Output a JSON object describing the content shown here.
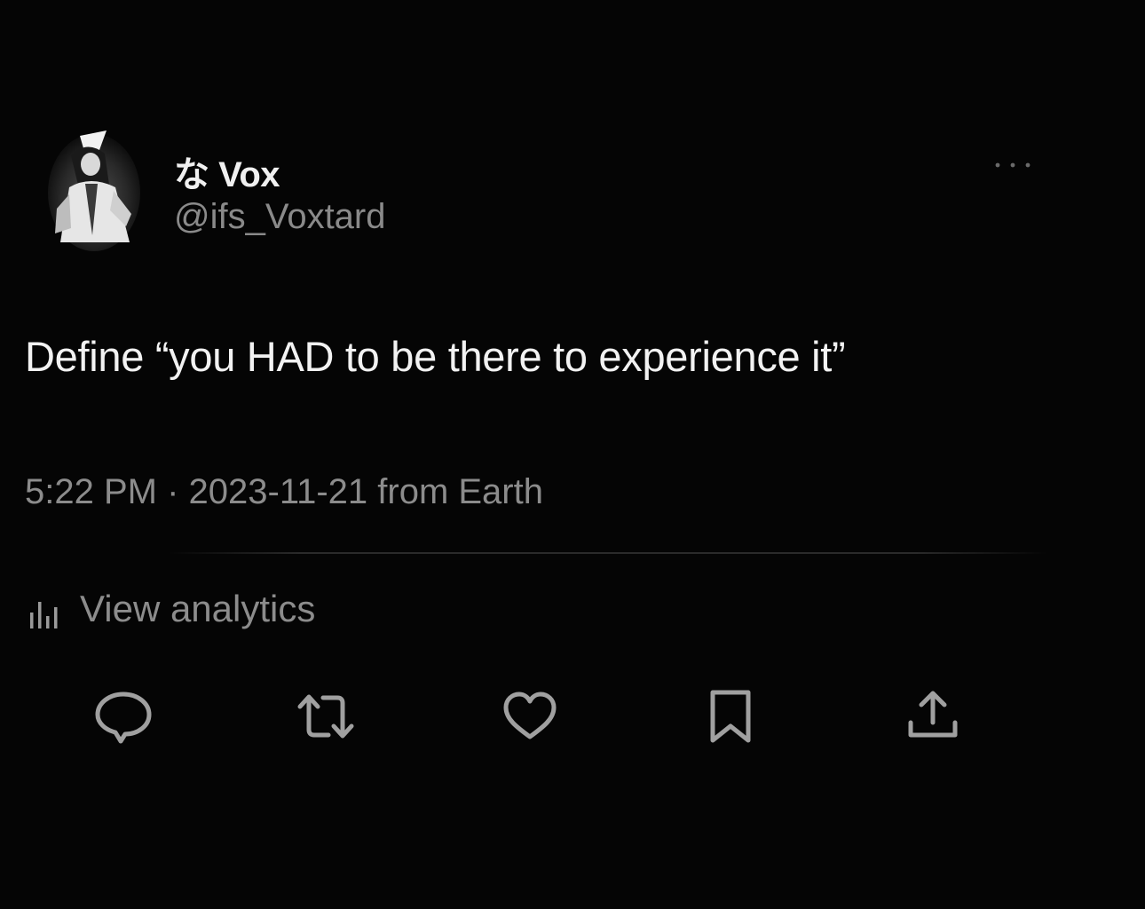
{
  "author": {
    "display_name": "な Vox",
    "handle": "@ifs_Voxtard",
    "avatar_icon": "avatar-image"
  },
  "tweet": {
    "text": "Define “you HAD to be there to experience it”",
    "meta": "5:22 PM · 2023-11-21 from Earth"
  },
  "analytics": {
    "label": "View analytics",
    "icon": "bar-chart-icon"
  },
  "actions": [
    {
      "name": "reply",
      "icon": "speech-bubble-icon"
    },
    {
      "name": "retweet",
      "icon": "retweet-arrows-icon"
    },
    {
      "name": "like",
      "icon": "heart-icon"
    },
    {
      "name": "bookmark",
      "icon": "bookmark-icon"
    },
    {
      "name": "share",
      "icon": "share-upload-icon"
    }
  ],
  "colors": {
    "background": "#050505",
    "text_primary": "#f2f2f2",
    "text_secondary": "#8c8c8c",
    "icon": "#9a9a9a"
  }
}
